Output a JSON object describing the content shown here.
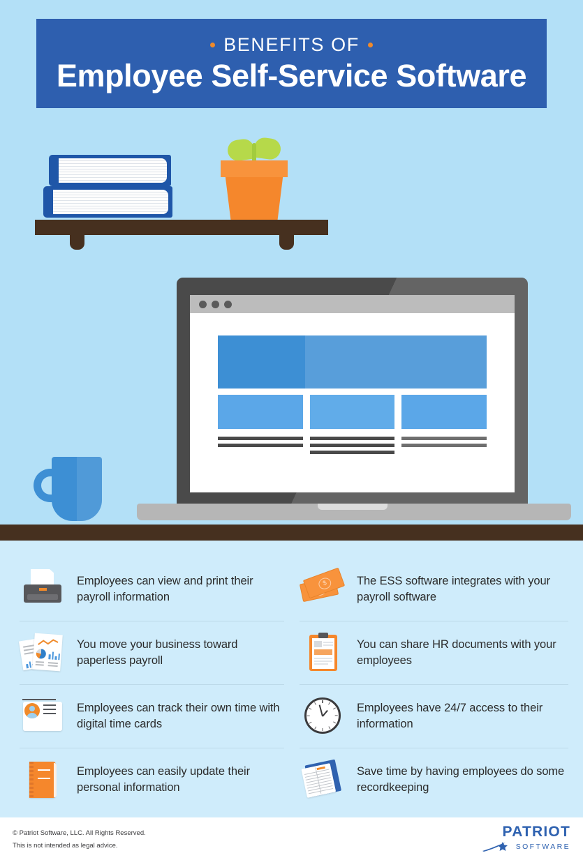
{
  "header": {
    "eyebrow": "BENEFITS OF",
    "title": "Employee Self-Service Software",
    "banner_color": "#2e5faf",
    "accent_color": "#f08a2a"
  },
  "scene": {
    "background_top_color": "#b3e0f7",
    "background_bottom_color": "#cfecfb",
    "desk_color": "#46301f",
    "items": [
      {
        "name": "books-stack",
        "color": "#1f56a8"
      },
      {
        "name": "potted-plant",
        "pot_color": "#f5872c",
        "leaf_color": "#b6d94a"
      },
      {
        "name": "shelf",
        "color": "#46301f"
      },
      {
        "name": "coffee-mug",
        "color": "#3d8fd4"
      },
      {
        "name": "laptop",
        "lid_color": "#4a4a4a",
        "base_color": "#b6b6b6",
        "screen_accent": "#3d8fd4"
      }
    ]
  },
  "benefits": {
    "left_column": [
      {
        "icon": "printer-icon",
        "text": "Employees can view and print their payroll information"
      },
      {
        "icon": "documents-chart-icon",
        "text": "You move your business toward paperless payroll"
      },
      {
        "icon": "id-card-icon",
        "text": "Employees can track their own time with digital time cards"
      },
      {
        "icon": "notebook-icon",
        "text": "Employees can easily update their personal information"
      }
    ],
    "right_column": [
      {
        "icon": "money-icon",
        "text": "The ESS software integrates with your payroll software"
      },
      {
        "icon": "clipboard-icon",
        "text": "You can share HR documents with your employees"
      },
      {
        "icon": "clock-icon",
        "text": "Employees have 24/7 access to their information"
      },
      {
        "icon": "ledger-book-icon",
        "text": "Save time by having employees do some recordkeeping"
      }
    ]
  },
  "footer": {
    "copyright": "© Patriot Software, LLC. All Rights Reserved.",
    "disclaimer": "This is not intended as legal advice.",
    "logo_word": "PATRIOT",
    "logo_sub": "SOFTWARE",
    "logo_color": "#2f62b0"
  }
}
